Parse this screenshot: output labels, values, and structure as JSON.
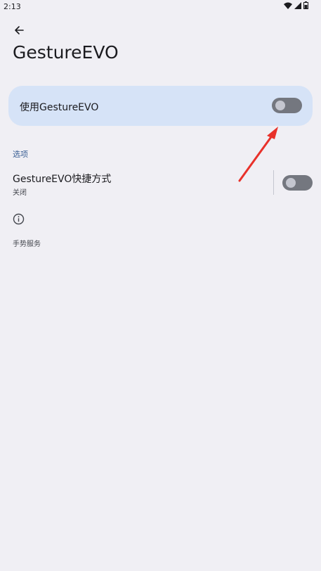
{
  "status_bar": {
    "time": "2:13",
    "icons": [
      "wifi-icon",
      "cellular-signal-icon",
      "battery-icon"
    ]
  },
  "header": {
    "back_icon": "arrow-back-icon",
    "title": "GestureEVO"
  },
  "main_switch": {
    "label": "使用GestureEVO",
    "enabled": false
  },
  "options_section": {
    "header": "选项",
    "shortcut": {
      "title": "GestureEVO快捷方式",
      "summary": "关闭",
      "enabled": false
    }
  },
  "footer": {
    "icon": "info-icon",
    "text": "手势服务"
  },
  "colors": {
    "background": "#f0eff4",
    "card": "#d6e3f7",
    "accent": "#3a5f94",
    "toggle_off_track": "#74777f",
    "annotation_arrow": "#e8312a"
  }
}
